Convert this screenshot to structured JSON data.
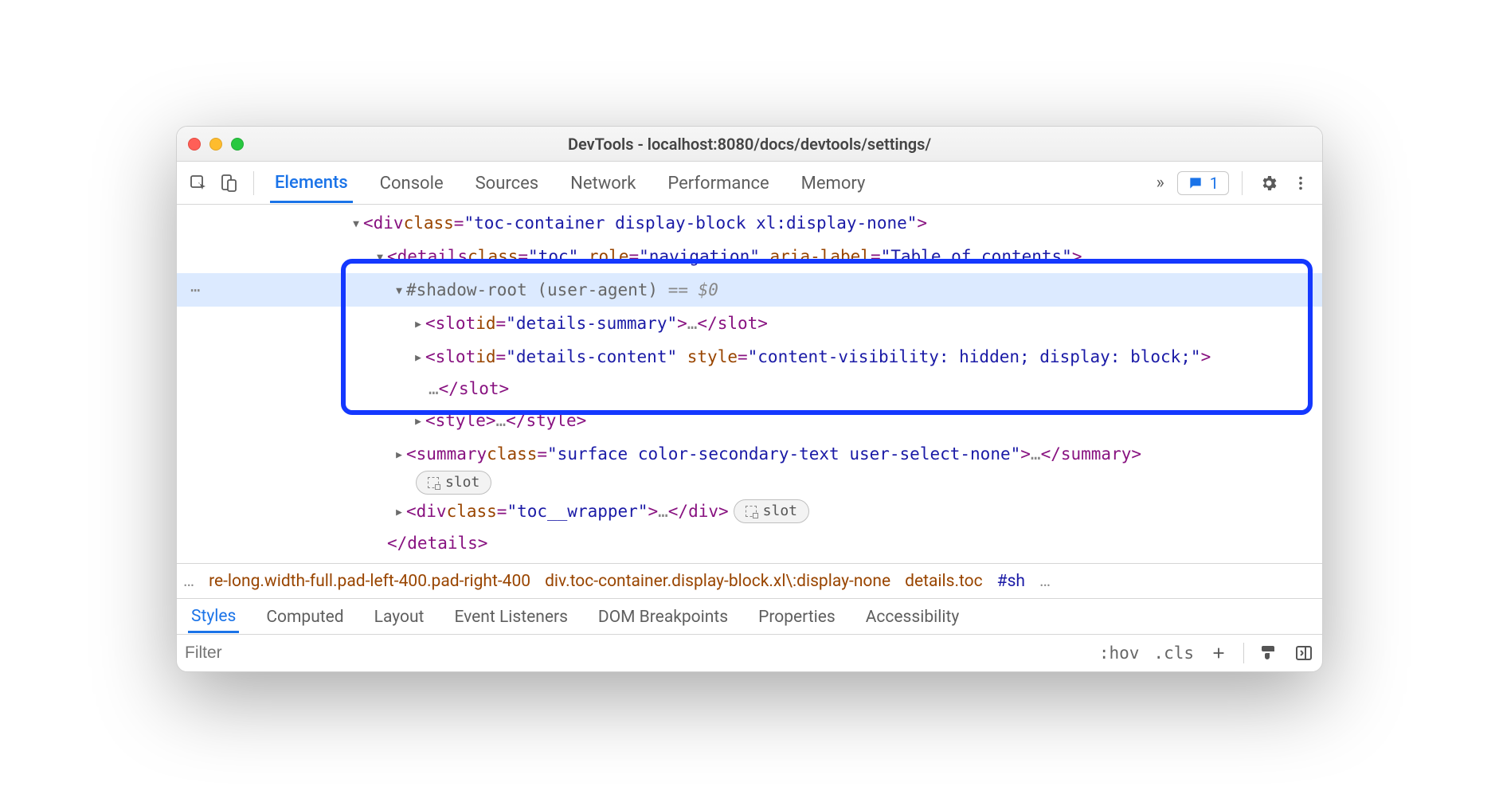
{
  "window": {
    "title": "DevTools - localhost:8080/docs/devtools/settings/"
  },
  "toolbar": {
    "tabs": [
      "Elements",
      "Console",
      "Sources",
      "Network",
      "Performance",
      "Memory"
    ],
    "activeTab": 0,
    "issuesCount": "1"
  },
  "dom": {
    "gutterEllipsis": "⋯",
    "row1": {
      "open": "<div ",
      "classAttr": "class",
      "classVal": "\"toc-container display-block xl:display-none\"",
      "close": ">"
    },
    "row2": {
      "open": "<details ",
      "classAttr": "class",
      "classVal": "\"toc\"",
      "roleAttr": "role",
      "roleVal": "\"navigation\"",
      "ariaAttr": "aria-label",
      "ariaVal": "\"Table of contents\"",
      "close": ">"
    },
    "row3": {
      "text": "#shadow-root (user-agent)",
      "marker": "== $0"
    },
    "row4": {
      "open": "<slot ",
      "idAttr": "id",
      "idVal": "\"details-summary\"",
      "close": ">",
      "ellipsis": "…",
      "end": "</slot>"
    },
    "row5": {
      "open": "<slot ",
      "idAttr": "id",
      "idVal": "\"details-content\"",
      "styleAttr": "style",
      "styleVal": "\"content-visibility: hidden; display: block;\"",
      "close": ">"
    },
    "row5b": {
      "ellipsis": "…",
      "end": "</slot>"
    },
    "row6": {
      "open": "<style>",
      "ellipsis": "…",
      "end": "</style>"
    },
    "row7": {
      "open": "<summary ",
      "classAttr": "class",
      "classVal": "\"surface color-secondary-text user-select-none\"",
      "close": ">",
      "ellipsis": "…",
      "end": "</summary>"
    },
    "row7slot": "slot",
    "row8": {
      "open": "<div ",
      "classAttr": "class",
      "classVal": "\"toc__wrapper\"",
      "close": ">",
      "ellipsis": "…",
      "end": "</div>"
    },
    "row8slot": "slot",
    "row9": {
      "end": "</details>"
    }
  },
  "crumbs": {
    "leadEllipsis": "…",
    "seg1": "re-long.width-full.pad-left-400.pad-right-400",
    "seg2": "div.toc-container.display-block.xl\\:display-none",
    "seg3": "details.toc",
    "seg4": "#sh",
    "trailEllipsis": "…"
  },
  "panelTabs": [
    "Styles",
    "Computed",
    "Layout",
    "Event Listeners",
    "DOM Breakpoints",
    "Properties",
    "Accessibility"
  ],
  "panelActive": 0,
  "filter": {
    "placeholder": "Filter",
    "hov": ":hov",
    "cls": ".cls"
  }
}
